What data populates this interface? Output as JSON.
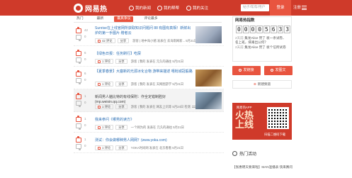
{
  "header": {
    "logo_text": "网易热",
    "nav": [
      {
        "label": "我的新闻"
      },
      {
        "label": "我的帮帮"
      },
      {
        "label": "我的关注"
      }
    ],
    "search_placeholder": "帖子/帮帮/用户",
    "login": "登录",
    "register": "注册"
  },
  "tabs": [
    {
      "label": "热门",
      "active": false
    },
    {
      "label": "最新",
      "active": false
    },
    {
      "label": "最具争议",
      "active": true
    },
    {
      "label": "评论最多",
      "active": false
    }
  ],
  "news": [
    {
      "up": "42",
      "down": "0",
      "title": "Sunrise在上线官网所获取知识问题问 88 有图有真相！新鲜出炉的第一手图片·赠者云",
      "pill1": "42 评论",
      "pill2": "分享",
      "meta": "游客 | 地中海小猪 发表在 去海南网新... 5月21日"
    },
    {
      "up": "6",
      "down": "0",
      "title": "【绿色日报：任务刷行】吃屎",
      "pill1": "1 评论",
      "pill2": "分享",
      "meta": "游客 | 我的 发表在 元久的通往 5月21日"
    },
    {
      "up": "6",
      "down": "0",
      "title": "【夏季春景】大塞新的光源冰化合物 游带来描述 嘻枇城冠般路",
      "pill1": "1 评论",
      "pill2": "分享",
      "meta": "游客 | 我的 发表在 天网图游学 5月21日"
    },
    {
      "up": "1",
      "down": "0",
      "title": "新闻男人脑比特的有线保附：作全定错制胜好(mp.weixin.qq.com)",
      "pill1": "1 评论",
      "pill2": "分享",
      "meta": "游客 | 我的 发表在 网友上讯等 5月24日 检测"
    },
    {
      "up": "1",
      "down": "0",
      "title": "我来参问《哪男的读方》",
      "pill1": "1 评论",
      "pill2": "分享",
      "meta": "一个网为的 发表在 元久的通往 5月21日"
    },
    {
      "up": "1",
      "down": "0",
      "title": "测试：你会做哪种男人网网？(www.yoka.com)",
      "pill1": "1 评论",
      "pill2": "分享",
      "meta": "YOKA时尚网 发表在 北京看看 5月21日"
    }
  ],
  "sidebar": {
    "title": "网易热指数",
    "total_label": "总数",
    "digits": [
      "0",
      "0",
      "0",
      "0",
      "5",
      "6",
      "3",
      "3"
    ],
    "updates": [
      {
        "time": "2天前",
        "text": "集龙Alice 赞了 坂一条试卷、名上班，病毒出公何？"
      },
      {
        "time": "2天前",
        "text": "集龙Alice 赞了 坂个信所试卷"
      }
    ],
    "btn_post": "发链接",
    "btn_text": "发图文",
    "new_channel": "新建频道",
    "promo_small": "网易热APP",
    "promo_big_1": "火热",
    "promo_big_2": "上线",
    "promo_sub": "扫描二维码下载",
    "hot_title": "热门活动",
    "hot_text": "【张惠明天要来啦】MAN温播表 快来赛问"
  },
  "colors": {
    "brand": "#cf3a2a",
    "accent": "#e8543f"
  }
}
